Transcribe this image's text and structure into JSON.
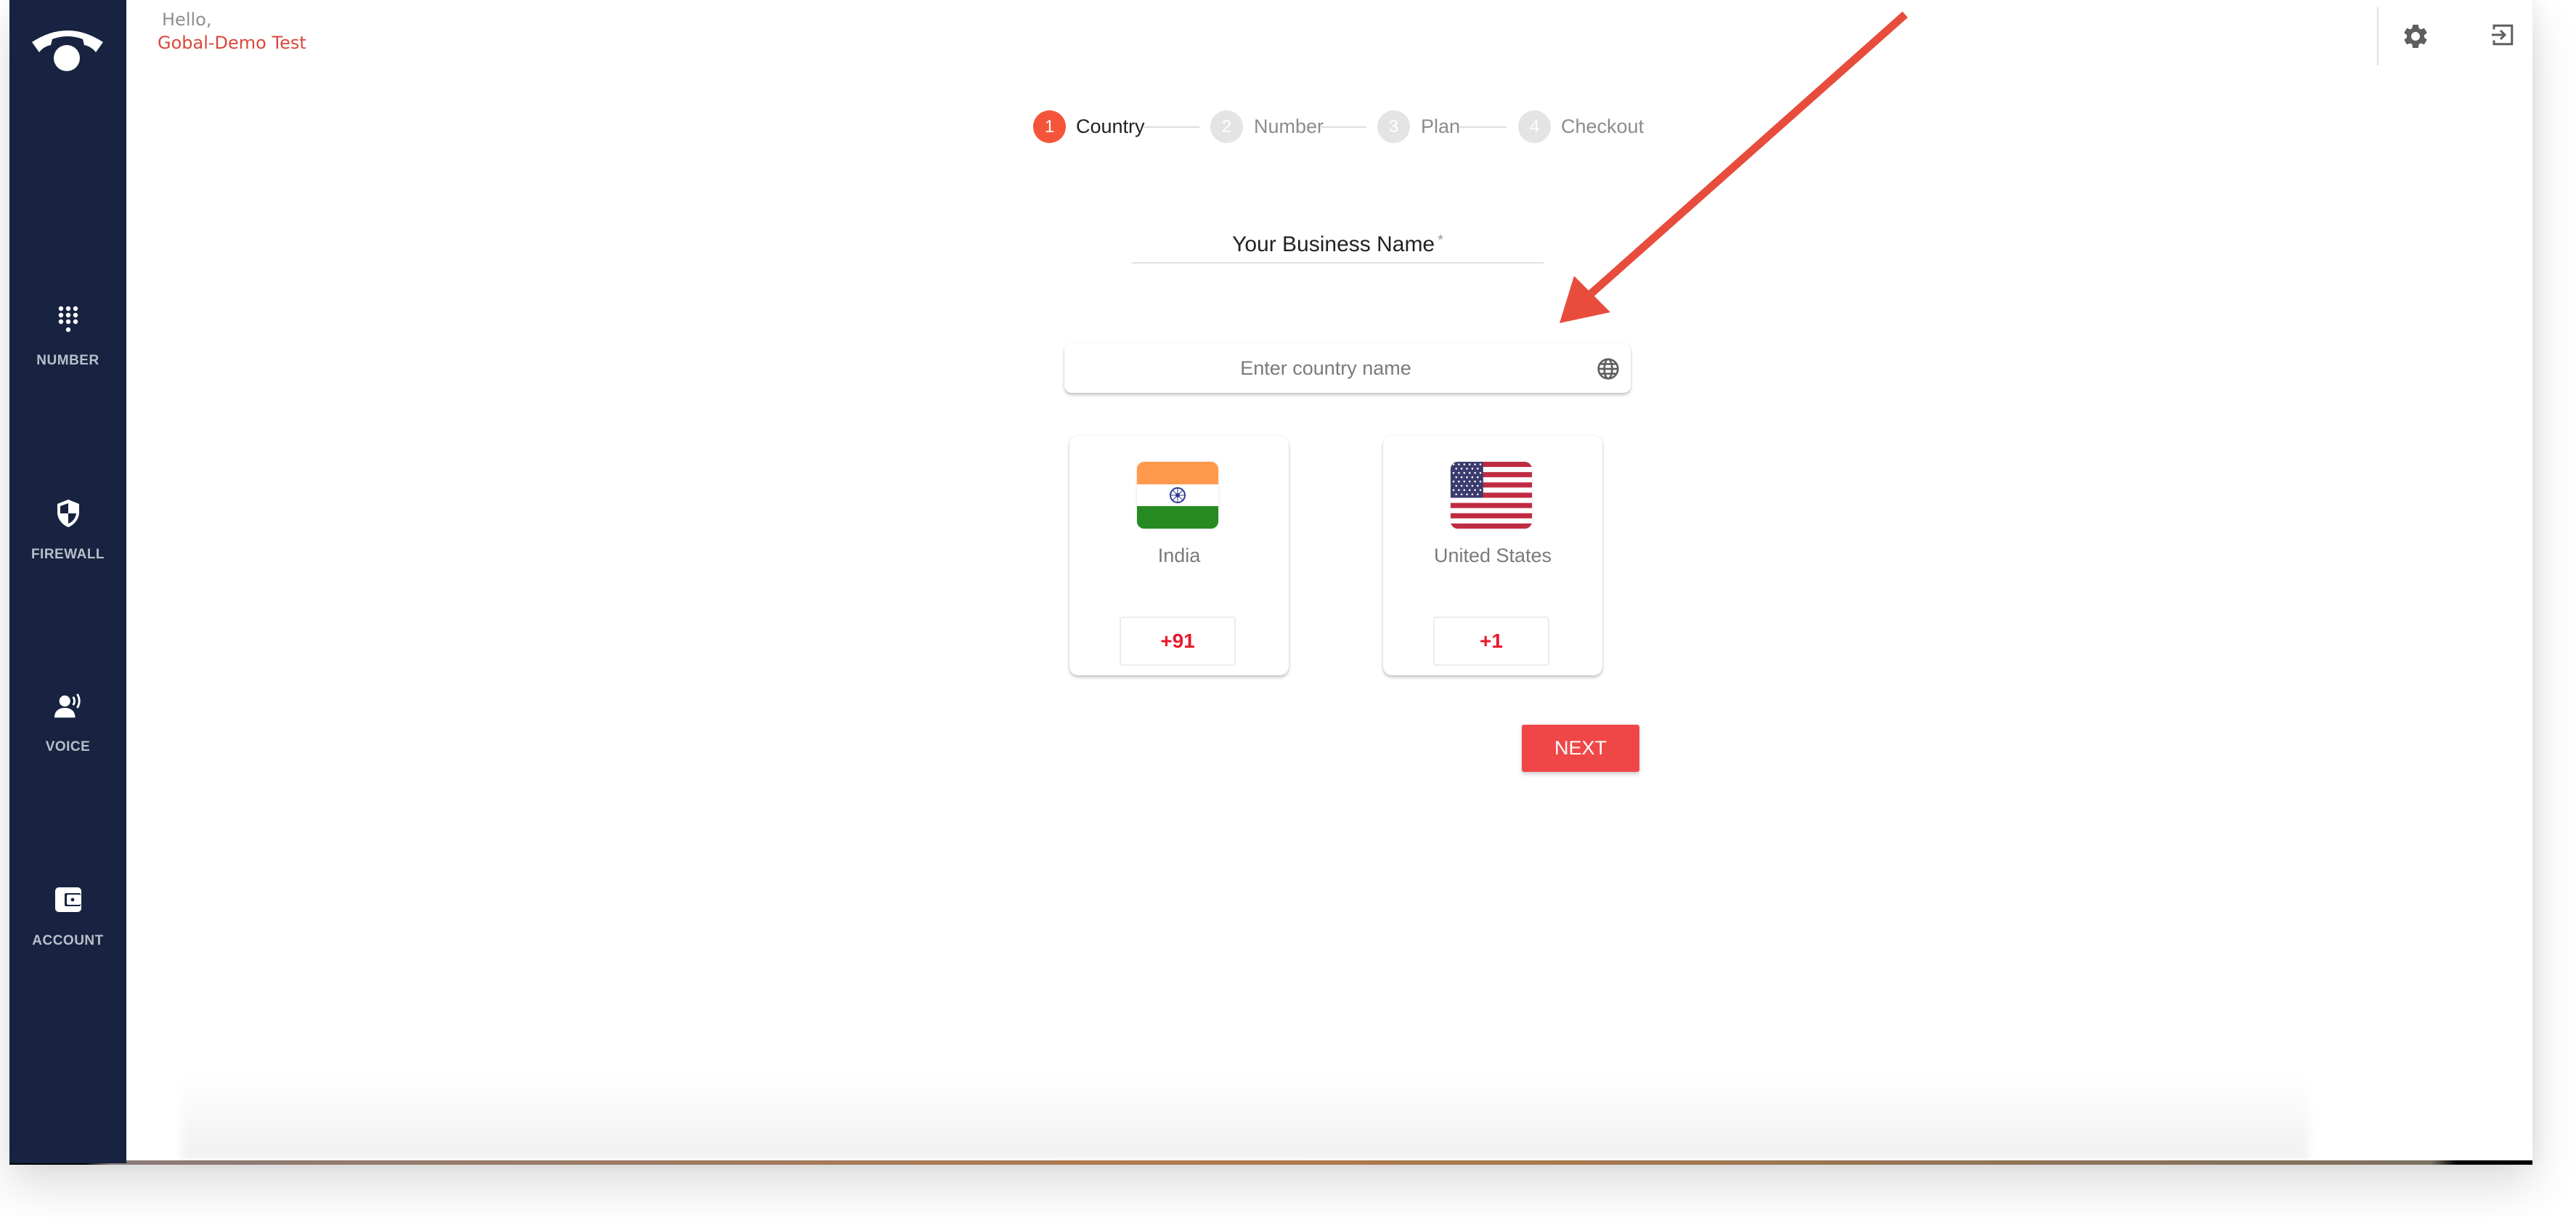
{
  "header": {
    "greeting": "Hello,",
    "user_name": "Gobal-Demo Test",
    "settings_icon": "gear-icon",
    "logout_icon": "exit-icon"
  },
  "sidebar": {
    "logo_icon": "phone-handset-icon",
    "items": [
      {
        "label": "NUMBER",
        "icon": "dialpad-icon"
      },
      {
        "label": "FIREWALL",
        "icon": "shield-icon"
      },
      {
        "label": "VOICE",
        "icon": "voice-user-icon"
      },
      {
        "label": "ACCOUNT",
        "icon": "wallet-icon"
      }
    ]
  },
  "stepper": {
    "active_step": 1,
    "steps": [
      {
        "number": "1",
        "label": "Country"
      },
      {
        "number": "2",
        "label": "Number"
      },
      {
        "number": "3",
        "label": "Plan"
      },
      {
        "number": "4",
        "label": "Checkout"
      }
    ]
  },
  "form": {
    "business_name_label": "Your Business Name",
    "business_name_required": "*",
    "business_name_value": "",
    "country_search_placeholder": "Enter country name",
    "country_search_value": "",
    "country_search_icon": "globe-icon"
  },
  "countries": [
    {
      "name": "India",
      "dial_code": "+91",
      "flag": "india-flag"
    },
    {
      "name": "United States",
      "dial_code": "+1",
      "flag": "us-flag"
    }
  ],
  "actions": {
    "next_label": "NEXT"
  },
  "colors": {
    "sidebar_bg": "#172340",
    "accent": "#f4553a",
    "next_button": "#ef4747",
    "dial_code": "#e8192c",
    "user_name": "#d9483b",
    "annotation_arrow": "#e84c3d"
  }
}
